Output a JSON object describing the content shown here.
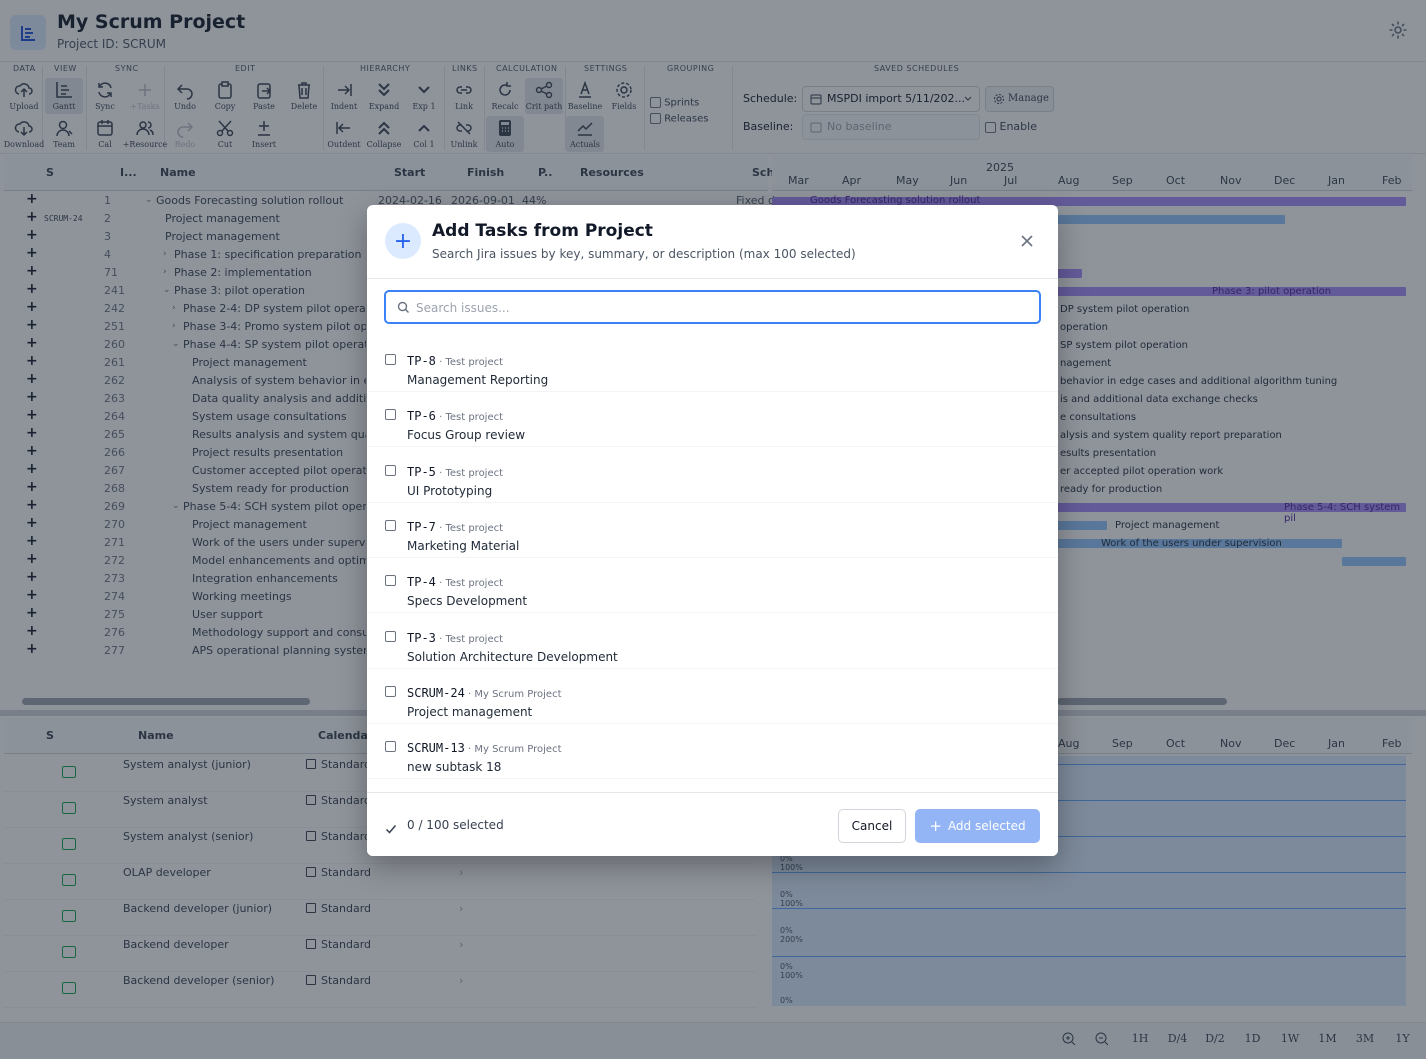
{
  "project": {
    "title": "My Scrum Project",
    "id_label": "Project ID: SCRUM"
  },
  "toolbar": {
    "groups": [
      "DATA",
      "VIEW",
      "SYNC",
      "EDIT",
      "HIERARCHY",
      "LINKS",
      "CALCULATION",
      "SETTINGS",
      "GROUPING",
      "SAVED SCHEDULES"
    ],
    "upload": "Upload",
    "download": "Download",
    "gantt": "Gantt",
    "team": "Team",
    "sync": "Sync",
    "add_tasks": "+Tasks",
    "cal": "Cal",
    "add_resource": "+Resource",
    "undo": "Undo",
    "redo": "Redo",
    "copy": "Copy",
    "cut": "Cut",
    "paste": "Paste",
    "insert": "Insert",
    "delete": "Delete",
    "indent": "Indent",
    "outdent": "Outdent",
    "expand": "Expand",
    "collapse": "Collapse",
    "exp1": "Exp 1",
    "col1": "Col 1",
    "link": "Link",
    "unlink": "Unlink",
    "recalc": "Recalc",
    "auto": "Auto",
    "crit_path": "Crit path",
    "baseline": "Baseline",
    "actuals": "Actuals",
    "fields": "Fields",
    "sprints": "Sprints",
    "releases": "Releases",
    "schedule_label": "Schedule:",
    "schedule_value": "MSPDI import 5/11/202...",
    "manage": "Manage",
    "baseline_label": "Baseline:",
    "baseline_placeholder": "No baseline",
    "enable": "Enable"
  },
  "grid": {
    "columns": [
      "S",
      "I...",
      "Name",
      "Start",
      "Finish",
      "P..",
      "Resources",
      "Sch"
    ],
    "rows": [
      {
        "s": "",
        "id": "1",
        "name": "Goods Forecasting solution rollout",
        "start": "2024-02-16",
        "finish": "2026-09-01",
        "p": "44%",
        "sch": "Fixed d"
      },
      {
        "s": "SCRUM-24",
        "id": "2",
        "name": "Project management"
      },
      {
        "s": "",
        "id": "3",
        "name": "Project management"
      },
      {
        "s": "",
        "id": "4",
        "name": "Phase 1: specification preparation"
      },
      {
        "s": "",
        "id": "71",
        "name": "Phase 2: implementation"
      },
      {
        "s": "",
        "id": "241",
        "name": "Phase 3: pilot operation"
      },
      {
        "s": "",
        "id": "242",
        "name": "Phase 2-4: DP system pilot operation"
      },
      {
        "s": "",
        "id": "251",
        "name": "Phase 3-4: Promo system pilot ope..."
      },
      {
        "s": "",
        "id": "260",
        "name": "Phase 4-4: SP system pilot operation"
      },
      {
        "s": "",
        "id": "261",
        "name": "Project management"
      },
      {
        "s": "",
        "id": "262",
        "name": "Analysis of system behavior in edg..."
      },
      {
        "s": "",
        "id": "263",
        "name": "Data quality analysis and addition..."
      },
      {
        "s": "",
        "id": "264",
        "name": "System usage consultations"
      },
      {
        "s": "",
        "id": "265",
        "name": "Results analysis and system qualit..."
      },
      {
        "s": "",
        "id": "266",
        "name": "Project results presentation"
      },
      {
        "s": "",
        "id": "267",
        "name": "Customer accepted pilot operatio..."
      },
      {
        "s": "",
        "id": "268",
        "name": "System ready for production"
      },
      {
        "s": "",
        "id": "269",
        "name": "Phase 5-4: SCH system pilot operat..."
      },
      {
        "s": "",
        "id": "270",
        "name": "Project management"
      },
      {
        "s": "",
        "id": "271",
        "name": "Work of the users under supervision"
      },
      {
        "s": "",
        "id": "272",
        "name": "Model enhancements and optimiz..."
      },
      {
        "s": "",
        "id": "273",
        "name": "Integration enhancements"
      },
      {
        "s": "",
        "id": "274",
        "name": "Working meetings"
      },
      {
        "s": "",
        "id": "275",
        "name": "User support"
      },
      {
        "s": "",
        "id": "276",
        "name": "Methodology support and consult..."
      },
      {
        "s": "",
        "id": "277",
        "name": "APS operational planning system ..."
      }
    ]
  },
  "gantt": {
    "year": "2025",
    "months": [
      "Mar",
      "Apr",
      "May",
      "Jun",
      "Jul",
      "Aug",
      "Sep",
      "Oct",
      "Nov",
      "Dec",
      "Jan",
      "Feb"
    ],
    "bar_labels": [
      "Goods Forecasting solution rollout",
      "Phase 3: pilot operation",
      "DP system pilot operation",
      "operation",
      "SP system pilot operation",
      "nagement",
      "behavior in edge cases and additional algorithm tuning",
      "is and additional data exchange checks",
      "e consultations",
      "alysis and system quality report preparation",
      "esults presentation",
      "er accepted pilot operation work",
      "ready for production",
      "Phase 5-4: SCH system pil",
      "Project management",
      "Work of the users under supervision"
    ]
  },
  "resources": {
    "columns": [
      "S",
      "Name",
      "Calendar"
    ],
    "rows": [
      {
        "name": "System analyst (junior)",
        "calendar": "Standard"
      },
      {
        "name": "System analyst",
        "calendar": "Standard"
      },
      {
        "name": "System analyst (senior)",
        "calendar": "Standard"
      },
      {
        "name": "OLAP developer",
        "calendar": "Standard"
      },
      {
        "name": "Backend developer (junior)",
        "calendar": "Standard"
      },
      {
        "name": "Backend developer",
        "calendar": "Standard"
      },
      {
        "name": "Backend developer (senior)",
        "calendar": "Standard"
      }
    ],
    "months": [
      "Aug",
      "Sep",
      "Oct",
      "Nov",
      "Dec",
      "Jan",
      "Feb"
    ],
    "hist_labels": [
      "0%",
      "100%",
      "0%",
      "100%",
      "0%",
      "200%",
      "0%",
      "100%",
      "0%"
    ]
  },
  "zoom": [
    "1H",
    "D/4",
    "D/2",
    "1D",
    "1W",
    "1M",
    "3M",
    "1Y"
  ],
  "modal": {
    "title": "Add Tasks from Project",
    "subtitle": "Search Jira issues by key, summary, or description (max 100 selected)",
    "search_placeholder": "Search issues...",
    "items": [
      {
        "key": "TP-8",
        "project": "Test project",
        "summary": "Management Reporting"
      },
      {
        "key": "TP-6",
        "project": "Test project",
        "summary": "Focus Group review"
      },
      {
        "key": "TP-5",
        "project": "Test project",
        "summary": "UI Prototyping"
      },
      {
        "key": "TP-7",
        "project": "Test project",
        "summary": "Marketing Material"
      },
      {
        "key": "TP-4",
        "project": "Test project",
        "summary": "Specs Development"
      },
      {
        "key": "TP-3",
        "project": "Test project",
        "summary": "Solution Architecture Development"
      },
      {
        "key": "SCRUM-24",
        "project": "My Scrum Project",
        "summary": "Project management"
      },
      {
        "key": "SCRUM-13",
        "project": "My Scrum Project",
        "summary": "new subtask 18"
      }
    ],
    "selected_count": "0 / 100 selected",
    "cancel": "Cancel",
    "add_selected": "Add selected"
  },
  "colors": {
    "accent": "#3b82f6",
    "gantt_bar": "#a78bfa",
    "gantt_bar_light": "#93c5fd",
    "histogram": "#bfdbfe"
  }
}
